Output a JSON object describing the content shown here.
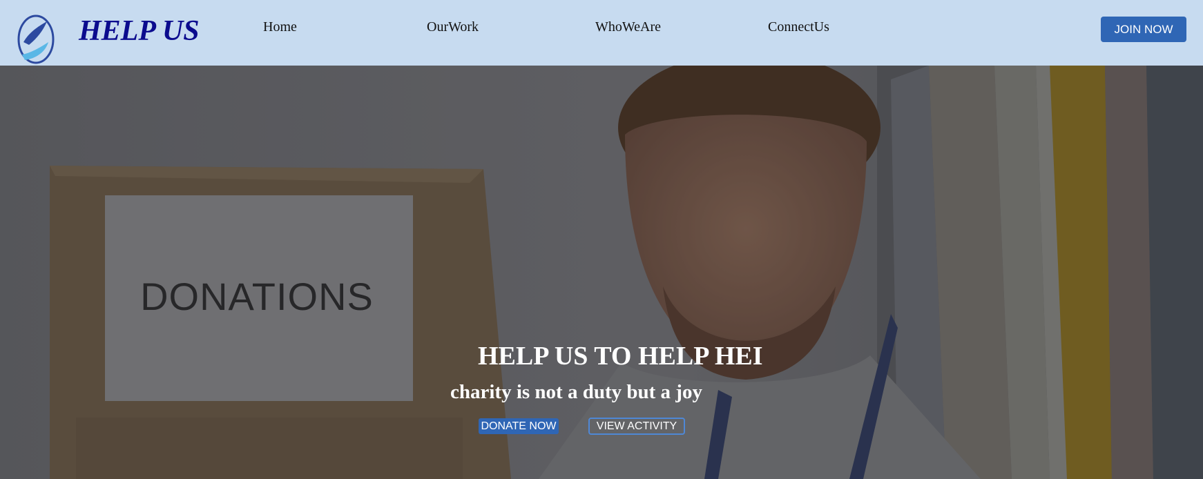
{
  "brand": {
    "name": "HELP US",
    "logo_icon": "hand-drop-logo-icon"
  },
  "nav": {
    "links": [
      "Home",
      "OurWork",
      "WhoWeAre",
      "ConnectUs"
    ],
    "join_label": "JOIN NOW"
  },
  "hero": {
    "title": "HELP US TO HELP HEI",
    "subtitle": "charity is not a duty but a joy",
    "donate_label": "DONATE NOW",
    "activity_label": "VIEW ACTIVITY",
    "box_label": "DONATIONS"
  },
  "colors": {
    "navbar_bg": "#c7dbf0",
    "brand_text": "#0b0b8e",
    "button_blue": "#2f66b5"
  }
}
